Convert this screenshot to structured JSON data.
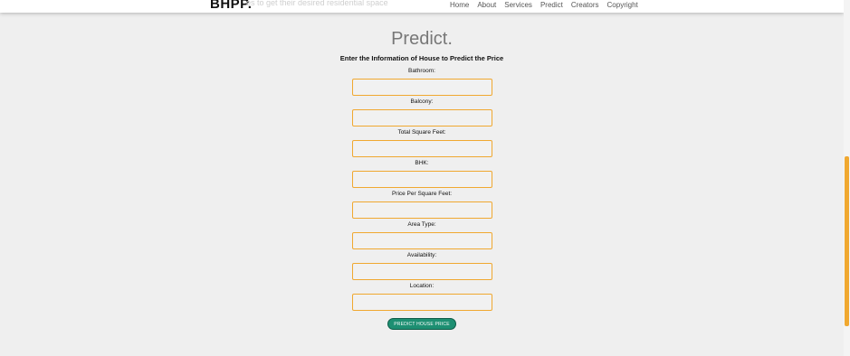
{
  "navbar": {
    "brand": "BHPP.",
    "tagline": "es to get their desired residential space",
    "links": [
      "Home",
      "About",
      "Services",
      "Predict",
      "Creators",
      "Copyright"
    ]
  },
  "main": {
    "title": "Predict.",
    "subtitle": "Enter the Information of House to Predict the Price",
    "fields": [
      {
        "label": "Bathroom:",
        "value": ""
      },
      {
        "label": "Balcony:",
        "value": ""
      },
      {
        "label": "Total Square Feet:",
        "value": ""
      },
      {
        "label": "BHK:",
        "value": ""
      },
      {
        "label": "Price Per Square Feet:",
        "value": ""
      },
      {
        "label": "Area Type:",
        "value": ""
      },
      {
        "label": "Availability:",
        "value": ""
      },
      {
        "label": "Location:",
        "value": ""
      }
    ],
    "submit_label": "PREDICT HOUSE PRICE"
  },
  "colors": {
    "accent": "#f0a830",
    "button": "#1d8f72",
    "background": "#efefef"
  }
}
